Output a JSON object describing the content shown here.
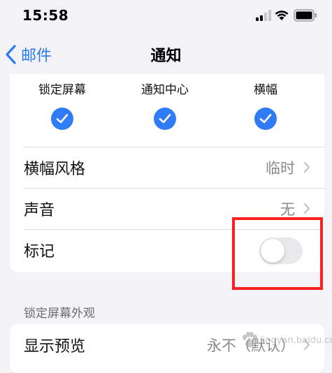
{
  "status_bar": {
    "time": "15:58",
    "icons": [
      "signal-icon",
      "wifi-icon",
      "battery-icon"
    ]
  },
  "nav": {
    "back_label": "邮件",
    "title": "通知"
  },
  "alert_styles": [
    {
      "label": "锁定屏幕",
      "checked": true
    },
    {
      "label": "通知中心",
      "checked": true
    },
    {
      "label": "横幅",
      "checked": true
    }
  ],
  "rows": {
    "banner_style": {
      "label": "横幅风格",
      "value": "临时"
    },
    "sound": {
      "label": "声音",
      "value": "无"
    },
    "badges": {
      "label": "标记",
      "on": false
    }
  },
  "lock_screen_section": {
    "header": "锁定屏幕外观",
    "show_previews": {
      "label": "显示预览",
      "value": "永不（默认）"
    }
  },
  "watermark": {
    "text": "jingyan.baidu.com"
  },
  "colors": {
    "accent": "#2f7cf6",
    "highlight": "#ff1f1f",
    "background": "#f2f2f7"
  }
}
